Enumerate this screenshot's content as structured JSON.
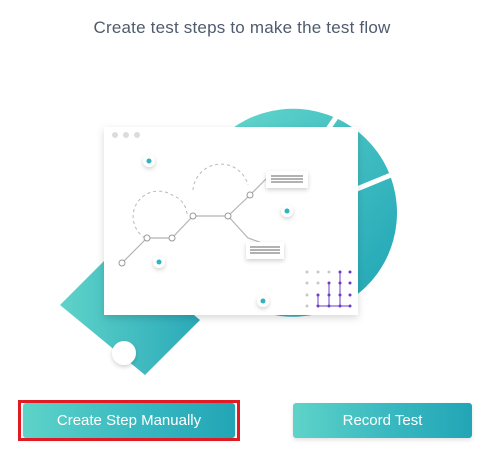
{
  "heading": "Create test steps to make the test flow",
  "actions": {
    "create_manual_label": "Create Step Manually",
    "record_label": "Record Test"
  },
  "colors": {
    "accent_teal": "#2fb3bf",
    "accent_teal_light": "#5ed3c9",
    "highlight_red": "#e01b24",
    "heading_text": "#4f5b6e",
    "grid_dots": "#6a3cc9"
  }
}
